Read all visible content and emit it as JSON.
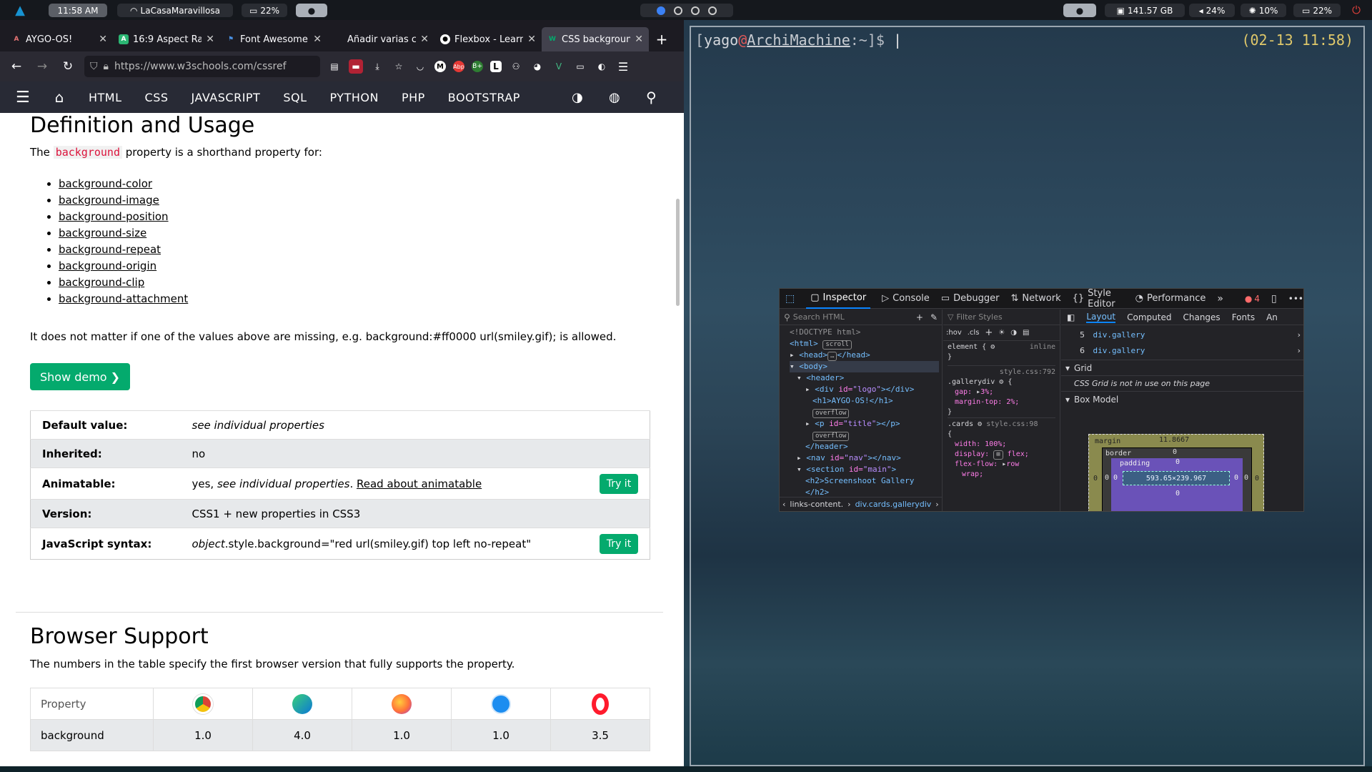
{
  "topbar": {
    "clock": "11:58 AM",
    "wifi": "LaCasaMaravillosa",
    "battery_left": "22%",
    "disk": "141.57 GB",
    "volume": "24%",
    "brightness": "10%",
    "battery_right": "22%"
  },
  "browser": {
    "tabs": [
      {
        "title": "AYGO-OS!"
      },
      {
        "title": "16:9 Aspect Ra"
      },
      {
        "title": "Font Awesome"
      },
      {
        "title": "Añadir varias c"
      },
      {
        "title": "Flexbox - Learn"
      },
      {
        "title": "CSS backgroun"
      }
    ],
    "url": "https://www.w3schools.com/cssref",
    "w3nav": [
      "HTML",
      "CSS",
      "JAVASCRIPT",
      "SQL",
      "PYTHON",
      "PHP",
      "BOOTSTRAP"
    ]
  },
  "article": {
    "heading": "Definition and Usage",
    "intro_pre": "The",
    "intro_kw": "background",
    "intro_post": "property is a shorthand property for:",
    "properties": [
      "background-color",
      "background-image",
      "background-position",
      "background-size",
      "background-repeat",
      "background-origin",
      "background-clip",
      "background-attachment"
    ],
    "note": "It does not matter if one of the values above are missing, e.g. background:#ff0000 url(smiley.gif); is allowed.",
    "show_demo": "Show demo ❯",
    "table": {
      "default_label": "Default value:",
      "default_value": "see individual properties",
      "inherited_label": "Inherited:",
      "inherited_value": "no",
      "animatable_label": "Animatable:",
      "animatable_value_pre": "yes,",
      "animatable_value_em": "see individual properties",
      "animatable_link": "Read about animatable",
      "version_label": "Version:",
      "version_value": "CSS1 + new properties in CSS3",
      "js_label": "JavaScript syntax:",
      "js_value_em": "object",
      "js_value": ".style.background=\"red url(smiley.gif) top left no-repeat\"",
      "try_it": "Try it"
    },
    "support_heading": "Browser Support",
    "support_text": "The numbers in the table specify the first browser version that fully supports the property.",
    "support_table": {
      "property_label": "Property",
      "row_name": "background",
      "versions": [
        "1.0",
        "4.0",
        "1.0",
        "1.0",
        "3.5"
      ]
    }
  },
  "terminal": {
    "user": "yago",
    "at": "@",
    "host": "ArchiMachine",
    "path": ":~]$",
    "open_bracket": "[",
    "time": "(02-13 11:58)"
  },
  "devtools": {
    "tabs": [
      "Inspector",
      "Console",
      "Debugger",
      "Network",
      "Style Editor",
      "Performance"
    ],
    "error_count": "4",
    "search_placeholder": "Search HTML",
    "filter_placeholder": "Filter Styles",
    "hov": ":hov",
    "cls": ".cls",
    "layout_tabs": [
      "Layout",
      "Computed",
      "Changes",
      "Fonts",
      "An"
    ],
    "markup_lines": {
      "doctype": "<!DOCTYPE html>",
      "html": "<html>",
      "scroll": "scroll",
      "head": "<head>",
      "head_close": "</head>",
      "body": "<body>",
      "header": "<header>",
      "div_logo_open": "<div",
      "div_logo_attr": "id=",
      "div_logo_val": "\"logo\"",
      "div_close": "></div>",
      "h1": "<h1>AYGO-OS!</h1>",
      "overflow": "overflow",
      "p_open": "<p",
      "p_attr": "id=",
      "p_val": "\"title\"",
      "p_close": "></p>",
      "header_close": "</header>",
      "nav_open": "<nav",
      "nav_attr": "id=",
      "nav_val": "\"nav\"",
      "nav_close": "></nav>",
      "section_open": "<section",
      "section_attr": "id=",
      "section_val": "\"main\"",
      "h2": "<h2>Screenshoot Gallery",
      "h2_close": "</h2>"
    },
    "breadcrumb_1": "links-content.",
    "breadcrumb_2": "div.cards.gallerydiv",
    "rules": {
      "element": "element {",
      "inline": "inline",
      "close": "}",
      "gallerydiv_sel": ".gallerydiv",
      "gallerydiv_src": "style.css:792",
      "gap": "gap:",
      "gap_val": "3%;",
      "margin_top": "margin-top:",
      "margin_top_val": "2%;",
      "cards_sel": ".cards",
      "cards_src": "style.css:98",
      "open": "{",
      "width": "width:",
      "width_val": "100%;",
      "display": "display:",
      "display_val": "flex;",
      "flexflow": "flex-flow:",
      "flexflow_val": "row",
      "wrap": "wrap;"
    },
    "layout": {
      "gallery_5_num": "5",
      "gallery_6_num": "6",
      "gallery_label": "div.gallery",
      "grid_header": "Grid",
      "grid_note": "CSS Grid is not in use on this page",
      "boxmodel_header": "Box Model",
      "margin_label": "margin",
      "margin_top": "11.8667",
      "border_label": "border",
      "padding_label": "padding",
      "zero": "0",
      "size": "593.65×239.967"
    }
  }
}
